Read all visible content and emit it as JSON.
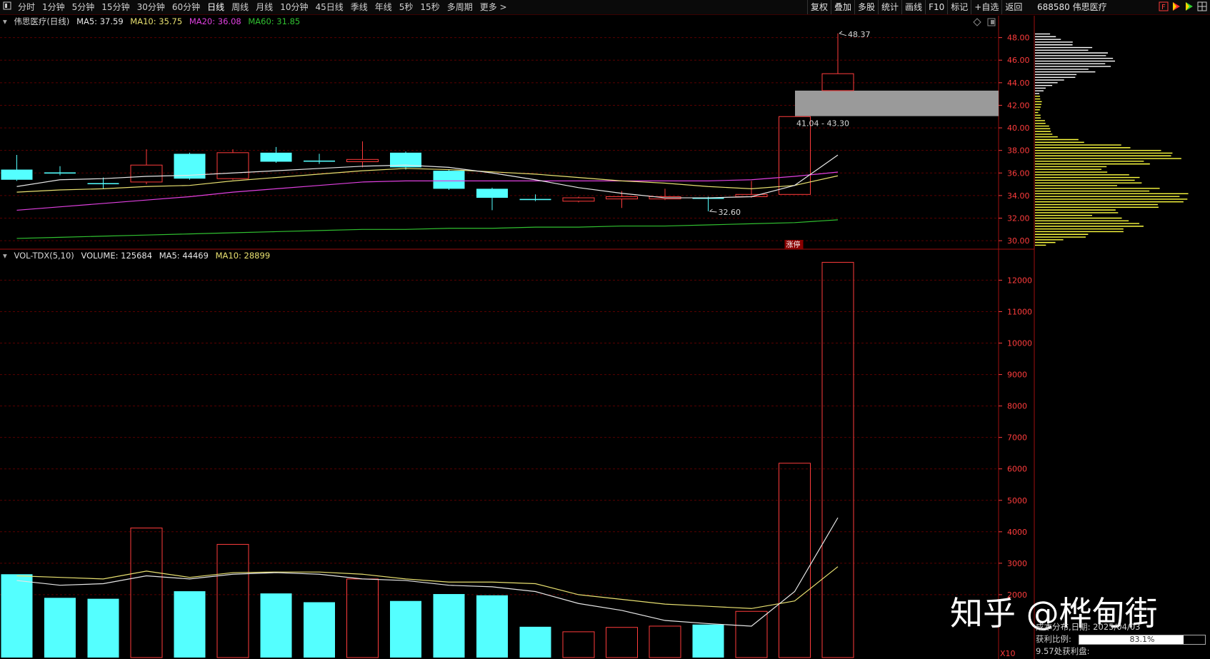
{
  "toolbar": {
    "periods": [
      "分时",
      "1分钟",
      "5分钟",
      "15分钟",
      "30分钟",
      "60分钟",
      "日线",
      "周线",
      "月线",
      "10分钟",
      "45日线",
      "季线",
      "年线",
      "5秒",
      "15秒",
      "多周期",
      "更多 >"
    ],
    "active_period": "日线",
    "right_items": [
      "复权",
      "叠加",
      "多股",
      "统计",
      "画线",
      "F10",
      "标记",
      "+自选",
      "返回"
    ],
    "stock_title": "688580 伟思医疗"
  },
  "ma_legend": {
    "name": "伟思医疗(日线)",
    "ma5": "MA5: 37.59",
    "ma10": "MA10: 35.75",
    "ma20": "MA20: 36.08",
    "ma60": "MA60: 31.85"
  },
  "vol_legend": {
    "name": "VOL-TDX(5,10)",
    "volume": "VOLUME: 125684",
    "ma5": "MA5: 44469",
    "ma10": "MA10: 28899"
  },
  "cost_info": {
    "row1": "成本分布,日期: 2025/04/03",
    "profit_label": "获利比例:",
    "profit_value": "83.1%",
    "profit_fraction": 0.831,
    "row3": "9.57处获利盘:"
  },
  "watermark": "知乎 @桦甸街",
  "colors": {
    "up": "#ff3c3c",
    "down": "#54ffff",
    "ma5": "#e6e6e6",
    "ma10": "#e8e070",
    "ma20": "#e040e0",
    "ma60": "#30c030",
    "axis": "#ff3c3c",
    "chip_profit": "#ffff40",
    "chip_loss": "#ffffff",
    "highlight_box": "#9a9a9a"
  },
  "chart_data": [
    {
      "type": "candlestick",
      "title": "伟思医疗(日线)",
      "y_ticks": [
        "30.00",
        "32.00",
        "34.00",
        "36.00",
        "38.00",
        "40.00",
        "42.00",
        "44.00",
        "46.00",
        "48.00"
      ],
      "ylim": [
        29.5,
        48.8
      ],
      "annotations": {
        "high_label": "48.37",
        "low_label": "32.60",
        "zone_label": "41.04 - 43.30",
        "zone_range": [
          41.04,
          43.3
        ],
        "limit_up_tag": "涨停"
      },
      "candles": [
        {
          "o": 35.4,
          "c": 36.3,
          "h": 37.6,
          "l": 35.3,
          "up": false
        },
        {
          "o": 36.05,
          "c": 35.95,
          "h": 36.6,
          "l": 35.8,
          "up": false
        },
        {
          "o": 35.1,
          "c": 35.05,
          "h": 35.6,
          "l": 34.6,
          "up": false
        },
        {
          "o": 35.2,
          "c": 36.7,
          "h": 38.1,
          "l": 35.0,
          "up": true
        },
        {
          "o": 37.7,
          "c": 35.5,
          "h": 37.8,
          "l": 35.4,
          "up": false
        },
        {
          "o": 35.5,
          "c": 37.8,
          "h": 38.1,
          "l": 35.4,
          "up": true
        },
        {
          "o": 37.8,
          "c": 37.0,
          "h": 38.3,
          "l": 36.9,
          "up": false
        },
        {
          "o": 37.1,
          "c": 37.0,
          "h": 37.7,
          "l": 36.8,
          "up": false
        },
        {
          "o": 37.0,
          "c": 37.2,
          "h": 38.8,
          "l": 36.5,
          "up": true
        },
        {
          "o": 37.8,
          "c": 36.5,
          "h": 37.9,
          "l": 36.3,
          "up": false
        },
        {
          "o": 36.2,
          "c": 34.6,
          "h": 36.3,
          "l": 34.5,
          "up": false
        },
        {
          "o": 34.6,
          "c": 33.8,
          "h": 34.7,
          "l": 32.7,
          "up": false
        },
        {
          "o": 33.7,
          "c": 33.6,
          "h": 34.1,
          "l": 33.5,
          "up": false
        },
        {
          "o": 33.5,
          "c": 33.8,
          "h": 33.9,
          "l": 33.4,
          "up": true
        },
        {
          "o": 33.7,
          "c": 33.9,
          "h": 34.4,
          "l": 32.9,
          "up": true
        },
        {
          "o": 33.7,
          "c": 33.9,
          "h": 34.6,
          "l": 33.6,
          "up": true
        },
        {
          "o": 33.8,
          "c": 33.8,
          "h": 33.9,
          "l": 32.6,
          "up": false
        },
        {
          "o": 33.9,
          "c": 34.1,
          "h": 35.3,
          "l": 33.8,
          "up": true
        },
        {
          "o": 34.1,
          "c": 41.0,
          "h": 41.0,
          "l": 34.1,
          "up": true
        },
        {
          "o": 43.3,
          "c": 44.8,
          "h": 48.37,
          "l": 43.3,
          "up": true
        }
      ],
      "ma5": [
        34.8,
        35.4,
        35.5,
        35.7,
        35.8,
        36.0,
        36.2,
        36.4,
        36.6,
        36.7,
        36.5,
        36.0,
        35.4,
        34.7,
        34.2,
        33.8,
        33.8,
        33.9,
        34.9,
        37.59
      ],
      "ma10": [
        34.3,
        34.5,
        34.6,
        34.8,
        34.9,
        35.3,
        35.6,
        35.9,
        36.2,
        36.4,
        36.3,
        36.1,
        35.9,
        35.6,
        35.3,
        35.1,
        34.8,
        34.6,
        34.9,
        35.75
      ],
      "ma20": [
        32.7,
        33.0,
        33.3,
        33.6,
        33.9,
        34.3,
        34.6,
        34.9,
        35.2,
        35.3,
        35.3,
        35.3,
        35.3,
        35.3,
        35.3,
        35.3,
        35.3,
        35.4,
        35.7,
        36.08
      ],
      "ma60": [
        30.2,
        30.3,
        30.4,
        30.5,
        30.6,
        30.7,
        30.8,
        30.9,
        31.0,
        31.0,
        31.1,
        31.1,
        31.2,
        31.2,
        31.3,
        31.3,
        31.4,
        31.5,
        31.6,
        31.85
      ]
    },
    {
      "type": "bar",
      "title": "VOL-TDX(5,10)",
      "y_ticks": [
        "2000",
        "3000",
        "4000",
        "5000",
        "6000",
        "7000",
        "8000",
        "9000",
        "10000",
        "11000",
        "12000"
      ],
      "ylim": [
        0,
        12600
      ],
      "unit_label": "X10",
      "volumes": [
        2650,
        1900,
        1870,
        4120,
        2110,
        3600,
        2040,
        1760,
        2500,
        1800,
        2020,
        1980,
        980,
        820,
        960,
        1000,
        1050,
        1470,
        6180,
        12568
      ],
      "up": [
        false,
        false,
        false,
        true,
        false,
        true,
        false,
        false,
        true,
        false,
        false,
        false,
        false,
        true,
        true,
        true,
        false,
        true,
        true,
        true
      ],
      "ma5": [
        2450,
        2300,
        2350,
        2600,
        2500,
        2650,
        2700,
        2650,
        2500,
        2450,
        2300,
        2250,
        2100,
        1720,
        1500,
        1180,
        1080,
        1000,
        2100,
        4447
      ],
      "ma10": [
        2600,
        2550,
        2500,
        2750,
        2550,
        2700,
        2720,
        2720,
        2650,
        2500,
        2400,
        2400,
        2350,
        2000,
        1850,
        1700,
        1630,
        1560,
        1800,
        2890
      ]
    }
  ]
}
